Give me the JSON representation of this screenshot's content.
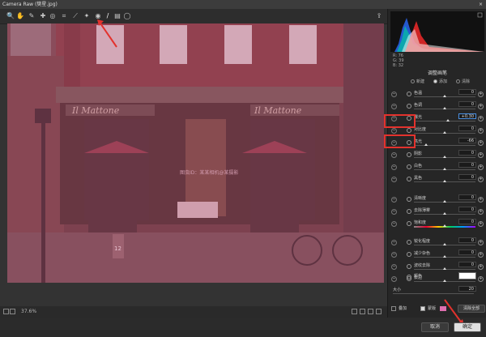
{
  "window": {
    "title": "Camera Raw (樊星.jpg)",
    "close_glyph": "×"
  },
  "toolbar": {
    "tools": [
      {
        "name": "zoom-tool-icon",
        "glyph": "🔍"
      },
      {
        "name": "hand-tool-icon",
        "glyph": "✋"
      },
      {
        "name": "white-balance-tool-icon",
        "glyph": "✎"
      },
      {
        "name": "color-sampler-tool-icon",
        "glyph": "✚"
      },
      {
        "name": "targeted-adjustment-tool-icon",
        "glyph": "◎"
      },
      {
        "name": "crop-tool-icon",
        "glyph": "⌗"
      },
      {
        "name": "straighten-tool-icon",
        "glyph": "⟋"
      },
      {
        "name": "spot-removal-tool-icon",
        "glyph": "✦"
      },
      {
        "name": "red-eye-tool-icon",
        "glyph": "◉"
      },
      {
        "name": "adjustment-brush-tool-icon",
        "glyph": "/"
      },
      {
        "name": "graduated-filter-tool-icon",
        "glyph": "▤"
      },
      {
        "name": "radial-filter-tool-icon",
        "glyph": "◯"
      }
    ],
    "export_glyph": "⇪"
  },
  "rgb": {
    "r": "R: 76",
    "g": "G: 39",
    "b": "B: 32"
  },
  "panel": {
    "title": "调整画笔",
    "modes": [
      "新建",
      "添加",
      "清除"
    ],
    "sliders": [
      {
        "label": "色温",
        "value": "0",
        "thumb": 0.5,
        "track": "plain"
      },
      {
        "label": "色调",
        "value": "0",
        "thumb": 0.5,
        "track": "plain"
      },
      {
        "label": "曝光",
        "value": "+0.30",
        "thumb": 0.55,
        "track": "plain",
        "hl": true
      },
      {
        "label": "对比度",
        "value": "0",
        "thumb": 0.5,
        "track": "plain"
      },
      {
        "label": "高光",
        "value": "-66",
        "thumb": 0.2,
        "track": "plain"
      },
      {
        "label": "阴影",
        "value": "0",
        "thumb": 0.5,
        "track": "plain"
      },
      {
        "label": "白色",
        "value": "0",
        "thumb": 0.5,
        "track": "plain"
      },
      {
        "label": "黑色",
        "value": "0",
        "thumb": 0.5,
        "track": "plain"
      },
      {
        "label": "清晰度",
        "value": "0",
        "thumb": 0.5,
        "track": "plain"
      },
      {
        "label": "去除薄雾",
        "value": "0",
        "thumb": 0.5,
        "track": "plain"
      },
      {
        "label": "饱和度",
        "value": "0",
        "thumb": 0.5,
        "track": "color"
      },
      {
        "label": "锐化程度",
        "value": "0",
        "thumb": 0.5,
        "track": "plain"
      },
      {
        "label": "减少杂色",
        "value": "0",
        "thumb": 0.5,
        "track": "plain"
      },
      {
        "label": "波纹去除",
        "value": "0",
        "thumb": 0.5,
        "track": "plain"
      },
      {
        "label": "去边",
        "value": "0",
        "thumb": 0.5,
        "track": "plain"
      }
    ],
    "color_label": "颜色",
    "size_label": "大小",
    "size_value": "20",
    "overlay_label": "叠加",
    "mask_label": "蒙版",
    "clear_all": "清除全部"
  },
  "bottombar": {
    "zoom": "37.6%"
  },
  "buttons": {
    "cancel": "取消",
    "ok": "确定"
  },
  "photo": {
    "sign_text": "Il Mattone",
    "door_number": "12",
    "watermark": "图虫ID：某某相机@某摄影"
  },
  "colors": {
    "accent": "#4a90e2",
    "annotation": "#e3322d",
    "overlay": "#c0507a"
  }
}
